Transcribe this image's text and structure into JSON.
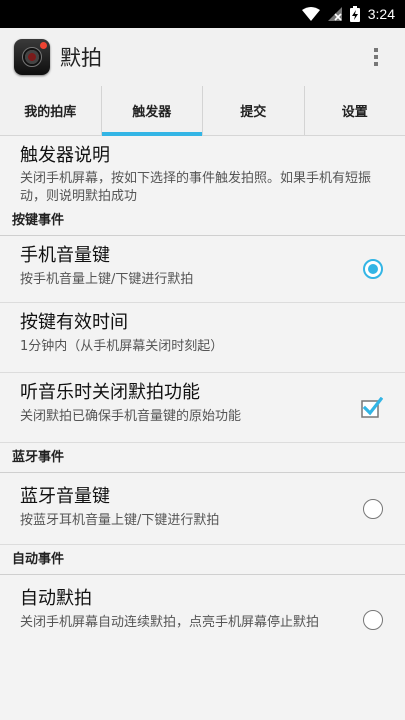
{
  "status_bar": {
    "time": "3:24"
  },
  "app_bar": {
    "title": "默拍"
  },
  "tabs": [
    {
      "label": "我的拍库",
      "active": false
    },
    {
      "label": "触发器",
      "active": true
    },
    {
      "label": "提交",
      "active": false
    },
    {
      "label": "设置",
      "active": false
    }
  ],
  "intro": {
    "title": "触发器说明",
    "summary": "关闭手机屏幕，按如下选择的事件触发拍照。如果手机有短振动，则说明默拍成功"
  },
  "categories": {
    "keys": "按键事件",
    "bluetooth": "蓝牙事件",
    "auto": "自动事件"
  },
  "prefs": {
    "volume_key": {
      "title": "手机音量键",
      "summary": "按手机音量上键/下键进行默拍",
      "selected": true
    },
    "key_time": {
      "title": "按键有效时间",
      "summary": "1分钟内（从手机屏幕关闭时刻起）"
    },
    "music_off": {
      "title": "听音乐时关闭默拍功能",
      "summary": "关闭默拍已确保手机音量键的原始功能",
      "checked": true
    },
    "bt_volume": {
      "title": "蓝牙音量键",
      "summary": "按蓝牙耳机音量上键/下键进行默拍",
      "selected": false
    },
    "auto_shot": {
      "title": "自动默拍",
      "summary": "关闭手机屏幕自动连续默拍，点亮手机屏幕停止默拍",
      "selected": false
    }
  },
  "colors": {
    "accent": "#33b5e5",
    "status_bar": "#000000"
  }
}
